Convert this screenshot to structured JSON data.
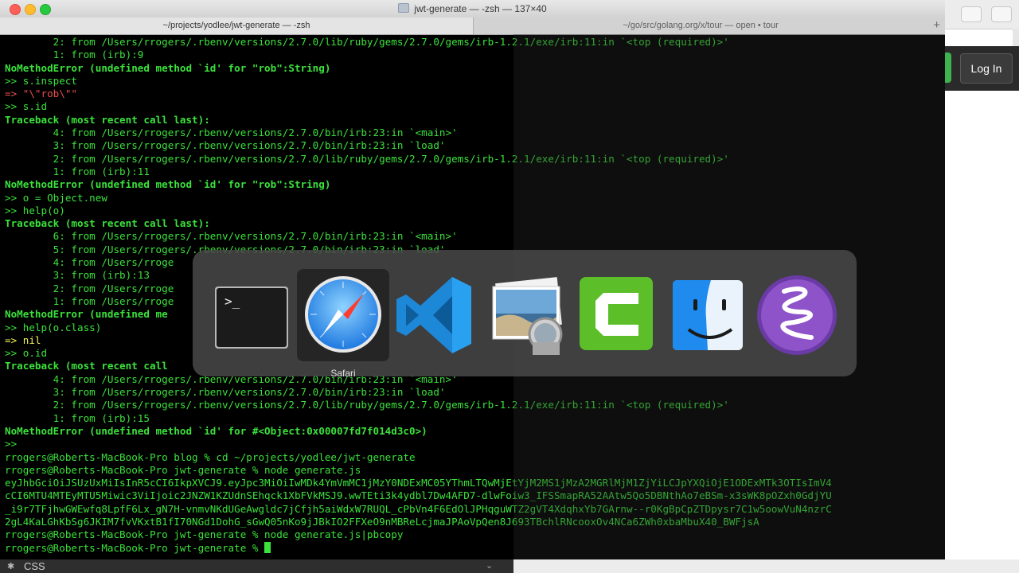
{
  "window": {
    "title": "jwt-generate — -zsh — 137×40"
  },
  "tabs": [
    {
      "label": "~/projects/yodlee/jwt-generate — -zsh",
      "active": true
    },
    {
      "label": "~/go/src/golang.org/x/tour — open • tour",
      "active": false
    }
  ],
  "new_tab_symbol": "+",
  "background_browser": {
    "login_label": "Log In",
    "accent_color": "#3fb34f"
  },
  "terminal_lines": [
    "        2: from /Users/rrogers/.rbenv/versions/2.7.0/lib/ruby/gems/2.7.0/gems/irb-1.2.1/exe/irb:11:in `<top (required)>'",
    "        1: from (irb):9",
    "NoMethodError (undefined method `id' for \"rob\":String)",
    ">> s.inspect",
    "=> \"\\\"rob\\\"\"",
    ">> s.id",
    "Traceback (most recent call last):",
    "        4: from /Users/rrogers/.rbenv/versions/2.7.0/bin/irb:23:in `<main>'",
    "        3: from /Users/rrogers/.rbenv/versions/2.7.0/bin/irb:23:in `load'",
    "        2: from /Users/rrogers/.rbenv/versions/2.7.0/lib/ruby/gems/2.7.0/gems/irb-1.2.1/exe/irb:11:in `<top (required)>'",
    "        1: from (irb):11",
    "NoMethodError (undefined method `id' for \"rob\":String)",
    ">> o = Object.new",
    ">> help(o)",
    "Traceback (most recent call last):",
    "        6: from /Users/rrogers/.rbenv/versions/2.7.0/bin/irb:23:in `<main>'",
    "        5: from /Users/rrogers/.rbenv/versions/2.7.0/bin/irb:23:in `load'",
    "        4: from /Users/rroge",
    "        3: from (irb):13",
    "        2: from /Users/rroge",
    "        1: from /Users/rroge",
    "NoMethodError (undefined me",
    ">> help(o.class)",
    "=> nil",
    ">> o.id",
    "Traceback (most recent call",
    "        4: from /Users/rrogers/.rbenv/versions/2.7.0/bin/irb:23:in `<main>'",
    "        3: from /Users/rrogers/.rbenv/versions/2.7.0/bin/irb:23:in `load'",
    "        2: from /Users/rrogers/.rbenv/versions/2.7.0/lib/ruby/gems/2.7.0/gems/irb-1.2.1/exe/irb:11:in `<top (required)>'",
    "        1: from (irb):15",
    "NoMethodError (undefined method `id' for #<Object:0x00007fd7f014d3c0>)",
    ">>",
    "rrogers@Roberts-MacBook-Pro blog % cd ~/projects/yodlee/jwt-generate",
    "rrogers@Roberts-MacBook-Pro jwt-generate % node generate.js",
    "eyJhbGciOiJSUzUxMiIsInR5cCI6IkpXVCJ9.eyJpc3MiOiIwMDk4YmVmMC1jMzY0NDExMC05YThmLTQwMjEtYjM2MS1jMzA2MGRlMjM1ZjYiLCJpYXQiOjE1ODExMTk3OTIsImV4",
    "cCI6MTU4MTEyMTU5Miwic3ViIjoic2JNZW1KZUdnSEhqck1XbFVkMSJ9.wwTEti3k4ydbl7Dw4AFD7-dlwFoiw3_IFSSmapRA52AAtw5Qo5DBNthAo7eBSm-x3sWK8pOZxh0GdjYU",
    "_i9r7TFjhwGWEwfq8LpfF6Lx_gN7H-vnmvNKdUGeAwgldc7jCfjh5aiWdxW7RUQL_cPbVn4F6EdOlJPHqguWTZ2gVT4XdqhxYb7GArnw--r0KgBpCpZTDpysr7C1w5oowVuN4nzrC",
    "2gL4KaLGhKbSg6JKIM7fvVKxtB1fI70NGd1DohG_sGwQ05nKo9jJBkIO2FFXeO9nMBReLcjmaJPAoVpQen8J693TBchlRNcooxOv4NCa6ZWh0xbaMbuX40_BWFjsA",
    "rrogers@Roberts-MacBook-Pro jwt-generate % node generate.js|pbcopy",
    "rrogers@Roberts-MacBook-Pro jwt-generate % "
  ],
  "app_switcher": {
    "selected_label": "Safari",
    "apps": [
      {
        "name": "Terminal",
        "icon": "terminal-icon"
      },
      {
        "name": "Safari",
        "icon": "safari-compass-icon"
      },
      {
        "name": "Visual Studio Code",
        "icon": "vscode-icon"
      },
      {
        "name": "Preview",
        "icon": "preview-photos-icon"
      },
      {
        "name": "Camtasia",
        "icon": "camtasia-icon"
      },
      {
        "name": "Finder",
        "icon": "finder-face-icon"
      },
      {
        "name": "Emacs",
        "icon": "emacs-icon"
      }
    ]
  },
  "bottom_bar": {
    "label": "CSS"
  }
}
